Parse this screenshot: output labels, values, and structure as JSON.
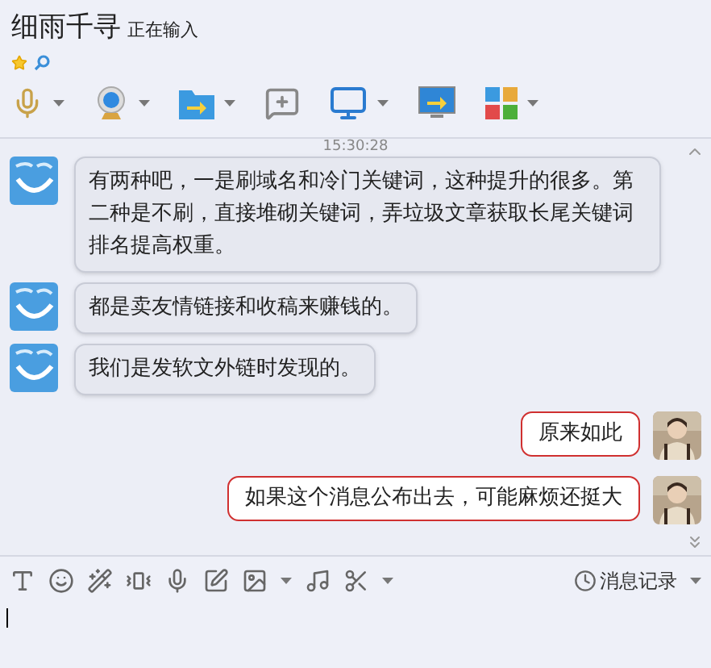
{
  "contact": {
    "name": "细雨千寻",
    "status": "正在输入"
  },
  "timestamp": "15:30:28",
  "messages": [
    {
      "kind": "incoming",
      "text": "有两种吧，一是刷域名和冷门关键词，这种提升的很多。第二种是不刷，直接堆砌关键词，弄垃圾文章获取长尾关键词排名提高权重。"
    },
    {
      "kind": "incoming",
      "text": "都是卖友情链接和收稿来赚钱的。"
    },
    {
      "kind": "incoming",
      "text": "我们是发软文外链时发现的。"
    },
    {
      "kind": "outgoing",
      "text": "原来如此"
    },
    {
      "kind": "outgoing",
      "text": "如果这个消息公布出去，可能麻烦还挺大"
    }
  ],
  "input_toolbar": {
    "history_label": "消息记录"
  }
}
